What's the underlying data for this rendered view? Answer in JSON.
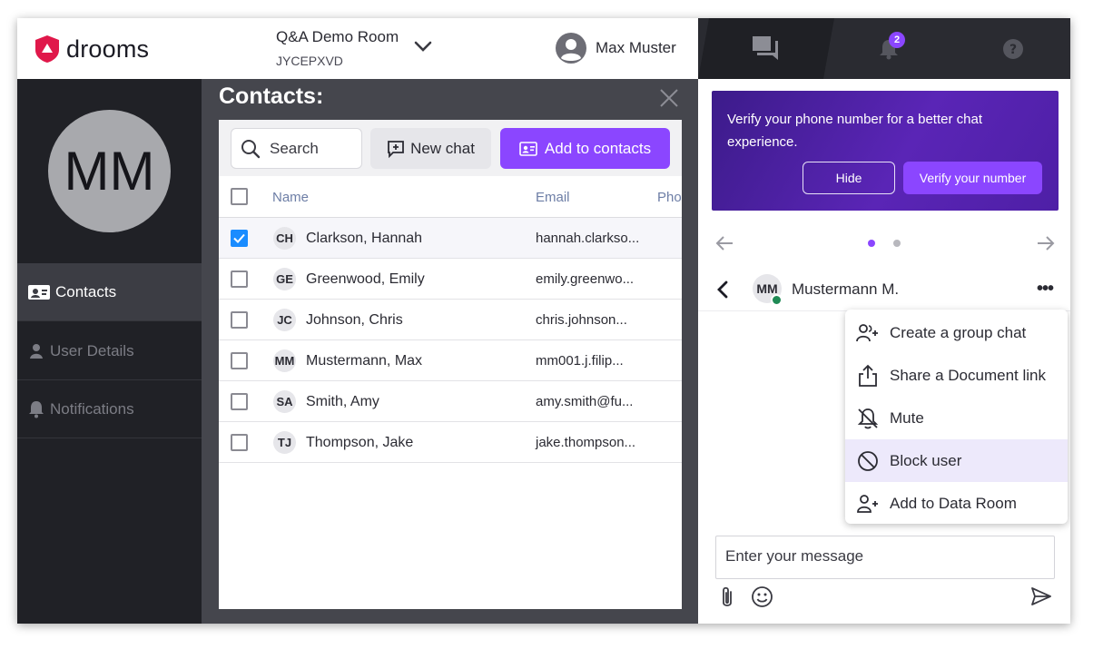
{
  "app": {
    "logo_text": "drooms",
    "brand_color": "#e0184a",
    "accent": "#8b46ff"
  },
  "room": {
    "name": "Q&A Demo Room",
    "code": "JYCEPXVD"
  },
  "user": {
    "name": "Max Muster"
  },
  "top_tabs": [
    {
      "icon": "chat-icon",
      "active": true
    },
    {
      "icon": "bell-icon",
      "badge": "2"
    },
    {
      "icon": "help-icon"
    }
  ],
  "sidebar": {
    "avatar_initials": "MM",
    "items": [
      {
        "label": "Contacts",
        "icon": "contact-card-icon",
        "active": true
      },
      {
        "label": "User Details",
        "icon": "person-icon"
      },
      {
        "label": "Notifications",
        "icon": "bell-icon"
      }
    ]
  },
  "contacts": {
    "title": "Contacts:",
    "search_label": "Search",
    "new_chat_label": "New chat",
    "add_to_contacts_label": "Add to contacts",
    "columns": [
      "Name",
      "Email",
      "Pho"
    ],
    "rows": [
      {
        "initials": "CH",
        "name": "Clarkson, Hannah",
        "email": "hannah.clarkso...",
        "checked": true
      },
      {
        "initials": "GE",
        "name": "Greenwood, Emily",
        "email": "emily.greenwo...",
        "checked": false
      },
      {
        "initials": "JC",
        "name": "Johnson, Chris",
        "email": "chris.johnson...",
        "checked": false
      },
      {
        "initials": "MM",
        "name": "Mustermann, Max",
        "email": "mm001.j.filip...",
        "checked": false
      },
      {
        "initials": "SA",
        "name": "Smith, Amy",
        "email": "amy.smith@fu...",
        "checked": false
      },
      {
        "initials": "TJ",
        "name": "Thompson, Jake",
        "email": "jake.thompson...",
        "checked": false
      }
    ]
  },
  "chat": {
    "verify_banner": {
      "text": "Verify your phone number for a better chat experience.",
      "hide_label": "Hide",
      "verify_label": "Verify your number"
    },
    "carousel": {
      "page": 1,
      "total": 2
    },
    "contact": {
      "initials": "MM",
      "name": "Mustermann M.",
      "status": "online"
    },
    "menu": [
      {
        "label": "Create a group chat",
        "icon": "group-add-icon"
      },
      {
        "label": "Share a Document link",
        "icon": "share-icon"
      },
      {
        "label": "Mute",
        "icon": "bell-off-icon"
      },
      {
        "label": "Block user",
        "icon": "block-icon",
        "highlighted": true
      },
      {
        "label": "Add to Data Room",
        "icon": "person-add-icon"
      }
    ],
    "input_placeholder": "Enter your message"
  }
}
